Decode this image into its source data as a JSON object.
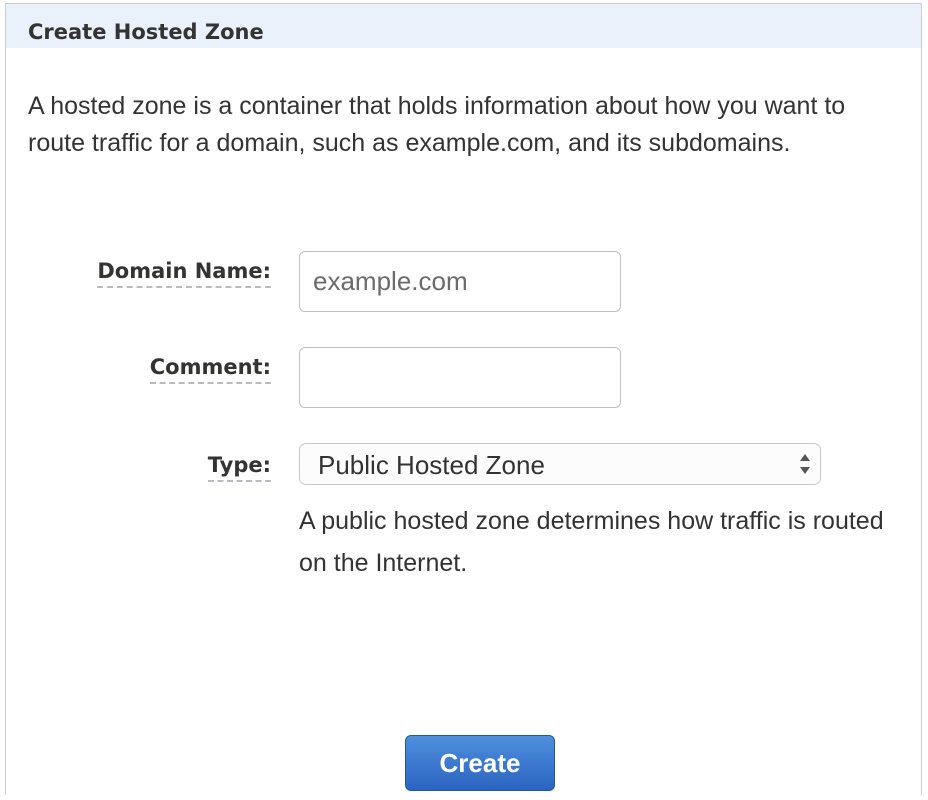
{
  "panel": {
    "title": "Create Hosted Zone",
    "intro": "A hosted zone is a container that holds information about how you want to route traffic for a domain, such as example.com, and its subdomains."
  },
  "form": {
    "domain_name": {
      "label": "Domain Name:",
      "value": "",
      "placeholder": "example.com"
    },
    "comment": {
      "label": "Comment:",
      "value": "",
      "placeholder": ""
    },
    "type": {
      "label": "Type:",
      "selected": "Public Hosted Zone",
      "help": "A public hosted zone determines how traffic is routed on the Internet."
    }
  },
  "actions": {
    "create_label": "Create"
  },
  "icons": {
    "select_arrows": "select-arrows-icon"
  },
  "colors": {
    "header_bg": "#eaf1fb",
    "button_primary": "#2f6fd1",
    "text": "#333333"
  }
}
